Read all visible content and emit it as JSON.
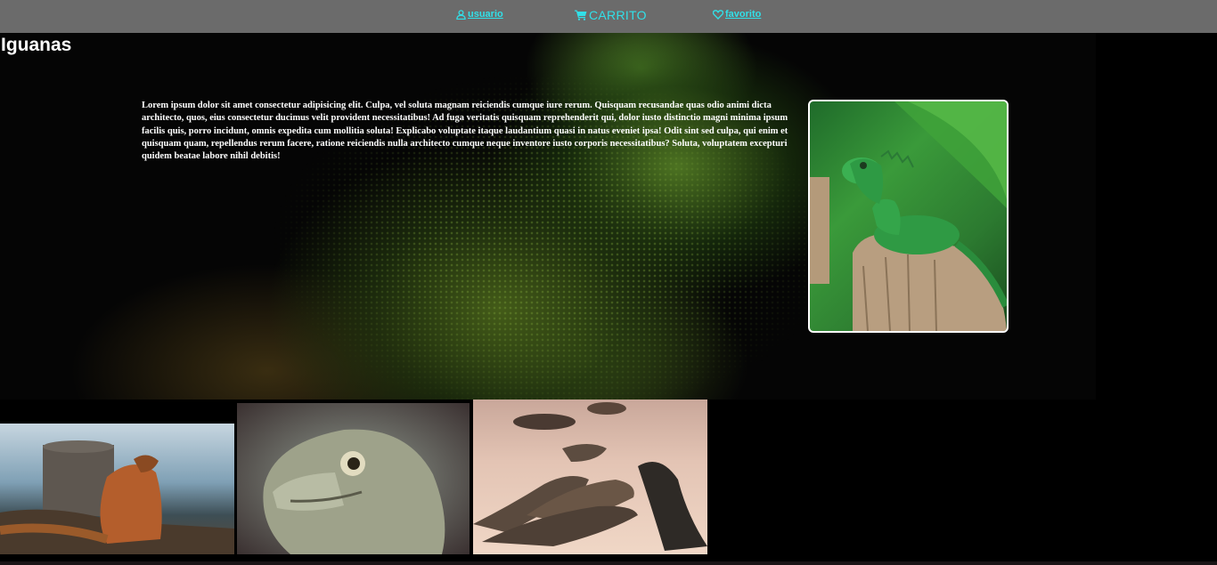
{
  "nav": {
    "user_label": "usuario",
    "cart_label": "CARRITO",
    "favorite_label": "favorito",
    "icons": [
      "user-icon",
      "cart-icon",
      "heart-icon"
    ],
    "link_color": "#31e0e8",
    "background_color": "#6b6b6b"
  },
  "page": {
    "title": "Iguanas",
    "intro": "Lorem ipsum dolor sit amet consectetur adipisicing elit. Culpa, vel soluta magnam reiciendis cumque iure rerum. Quisquam recusandae quas odio animi dicta architecto, quos, eius consectetur ducimus velit provident necessitatibus! Ad fuga veritatis quisquam reprehenderit qui, dolor iusto distinctio magni minima ipsum facilis quis, porro incidunt, omnis expedita cum mollitia soluta! Explicabo voluptate itaque laudantium quasi in natus eveniet ipsa! Odit sint sed culpa, qui enim et quisquam quam, repellendus rerum facere, ratione reiciendis nulla architecto cumque neque inventore iusto corporis necessitatibus? Soluta, voluptatem excepturi quidem beatae labore nihil debitis!"
  },
  "images": {
    "hero": "green-iguana-closeup-dark-background",
    "feature": "green-iguana-on-tree-stump",
    "gallery": [
      "iguana-by-the-sea",
      "iguana-head-closeup",
      "iguanas-group-on-sand"
    ]
  }
}
